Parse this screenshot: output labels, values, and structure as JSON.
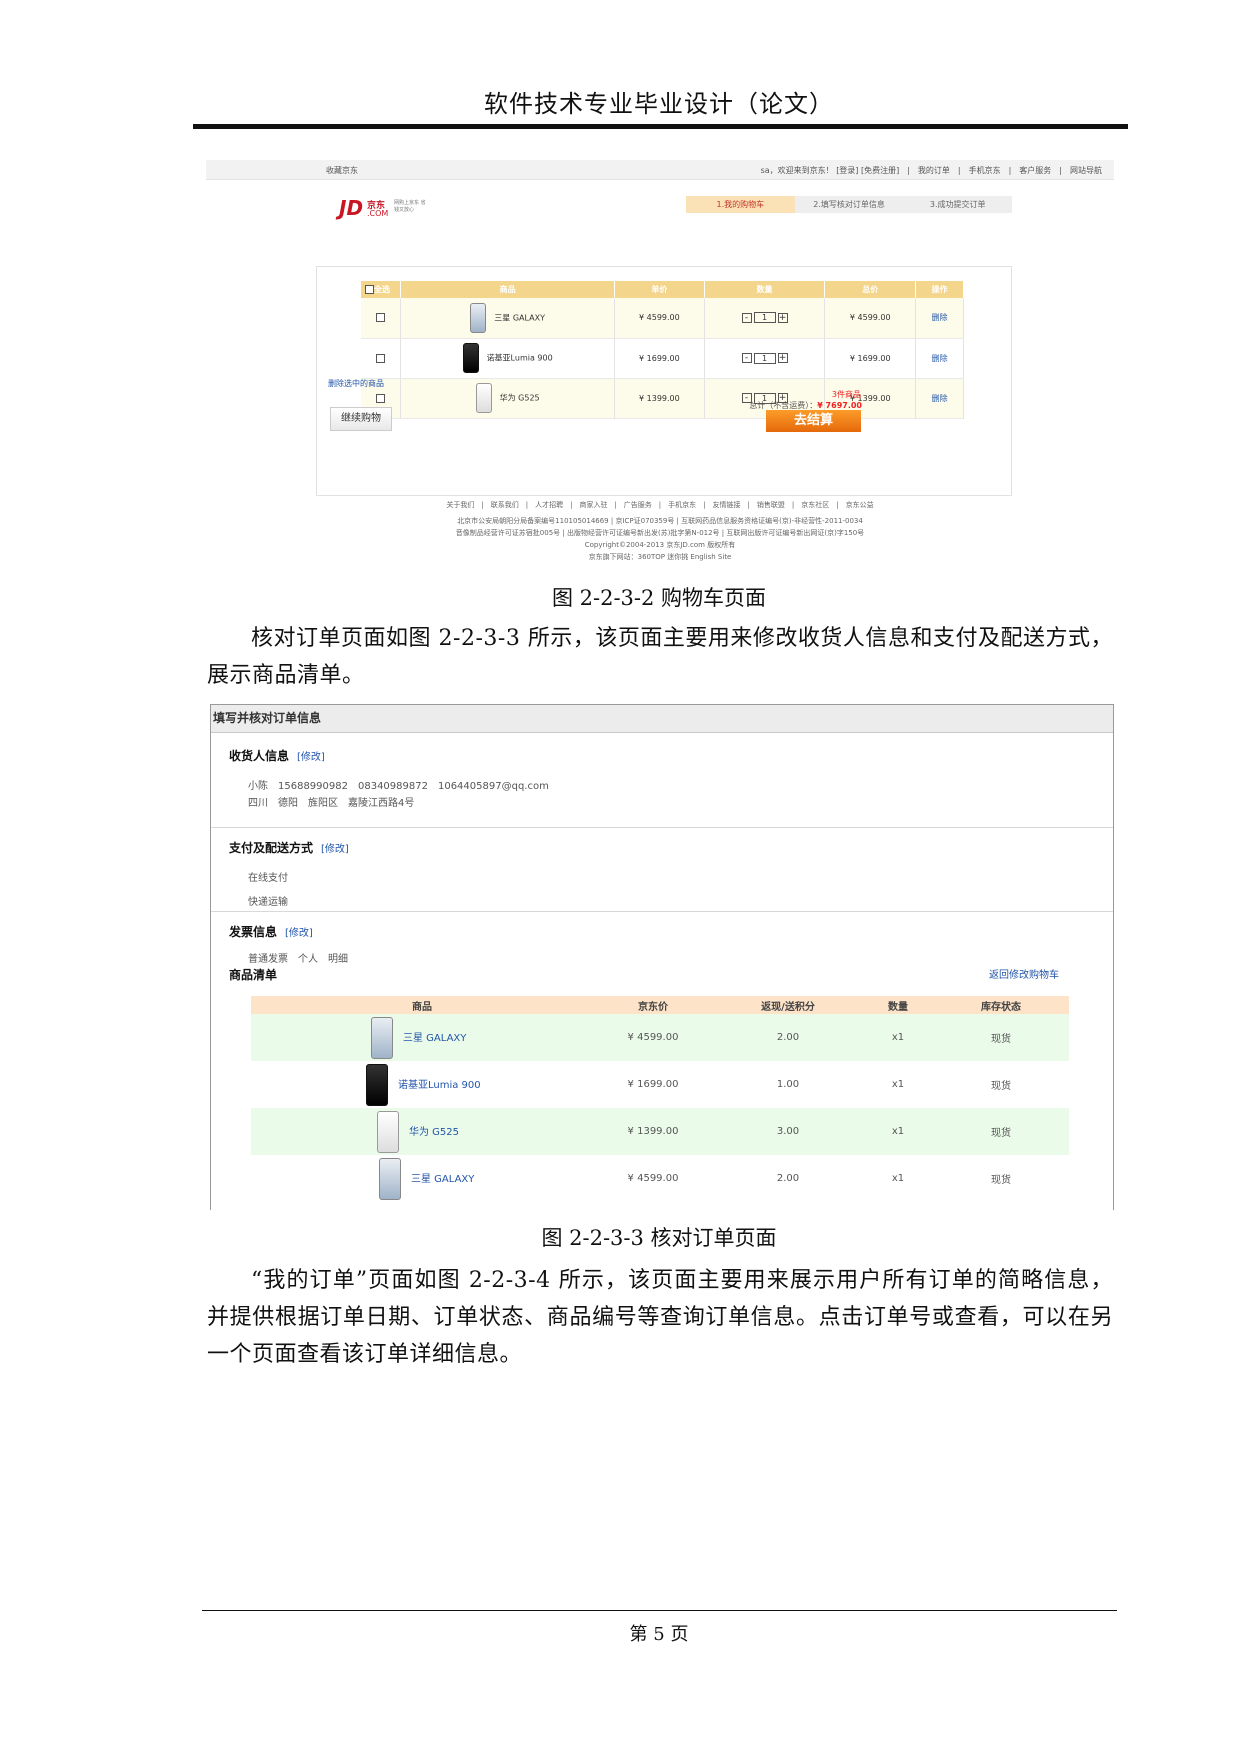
{
  "header": {
    "title": "软件技术专业毕业设计（论文）"
  },
  "fig1": {
    "topbar": {
      "favorite": "收藏京东",
      "links": "sa，欢迎来到京东！ [登录] [免费注册]　|　我的订单　|　手机京东　|　客户服务　|　网站导航"
    },
    "logo": {
      "mark": "JD",
      "name": "京东",
      "domain": ".COM",
      "slogan": "网购上京东 省钱又放心"
    },
    "steps": [
      "1.我的购物车",
      "2.填写核对订单信息",
      "3.成功提交订单"
    ],
    "table": {
      "headers": [
        "全选",
        "商品",
        "单价",
        "数量",
        "总价",
        "操作"
      ],
      "rows": [
        {
          "name": "三星 GALAXY",
          "price": "¥ 4599.00",
          "qty": "1",
          "total": "¥ 4599.00",
          "op": "删除"
        },
        {
          "name": "诺基亚Lumia 900",
          "price": "¥ 1699.00",
          "qty": "1",
          "total": "¥ 1699.00",
          "op": "删除"
        },
        {
          "name": "华为 G525",
          "price": "¥ 1399.00",
          "qty": "1",
          "total": "¥ 1399.00",
          "op": "删除"
        }
      ]
    },
    "delete_selected": "删除选中的商品",
    "count": "3件商品",
    "total_label": "总计（不含运费）：",
    "total_value": "¥ 7697.00",
    "continue_button": "继续购物",
    "checkout_button": "去结算",
    "footer": [
      "关于我们　|　联系我们　|　人才招聘　|　商家入驻　|　广告服务　|　手机京东　|　友情链接　|　销售联盟　|　京东社区　|　京东公益",
      "北京市公安局朝阳分局备案编号110105014669 | 京ICP证070359号 | 互联网药品信息服务资格证编号(京)-非经营性-2011-0034",
      "音像制品经营许可证苏宿批005号 | 出版物经营许可证编号新出发(苏)批字第N-012号 | 互联网出版许可证编号新出网证(京)字150号",
      "Copyright©2004-2013  京东JD.com 版权所有",
      "京东旗下网站：360TOP  迷你挑  English Site"
    ]
  },
  "captions": {
    "fig1": "图 2-2-3-2  购物车页面",
    "fig2": "图 2-2-3-3  核对订单页面"
  },
  "paragraphs": {
    "p1": "核对订单页面如图 2-2-3-3 所示，该页面主要用来修改收货人信息和支付及配送方式，展示商品清单。",
    "p2": "“我的订单”页面如图 2-2-3-4 所示，该页面主要用来展示用户所有订单的简略信息，并提供根据订单日期、订单状态、商品编号等查询订单信息。点击订单号或查看，可以在另一个页面查看该订单详细信息。"
  },
  "fig2": {
    "title": "填写并核对订单信息",
    "modify": "[修改]",
    "receiver": {
      "label": "收货人信息",
      "line1": "小陈　15688990982　08340989872　1064405897@qq.com",
      "line2": "四川　德阳　旌阳区　嘉陵江西路4号"
    },
    "payment": {
      "label": "支付及配送方式",
      "pay": "在线支付",
      "ship": "快递运输"
    },
    "invoice": {
      "label": "发票信息",
      "detail": "普通发票　个人　明细"
    },
    "list": {
      "label": "商品清单",
      "back": "返回修改购物车",
      "headers": [
        "商品",
        "京东价",
        "返现/送积分",
        "数量",
        "库存状态"
      ],
      "rows": [
        {
          "name": "三星 GALAXY",
          "price": "¥ 4599.00",
          "points": "2.00",
          "qty": "x1",
          "stock": "现货"
        },
        {
          "name": "诺基亚Lumia 900",
          "price": "¥ 1699.00",
          "points": "1.00",
          "qty": "x1",
          "stock": "现货"
        },
        {
          "name": "华为 G525",
          "price": "¥ 1399.00",
          "points": "3.00",
          "qty": "x1",
          "stock": "现货"
        },
        {
          "name": "三星 GALAXY",
          "price": "¥ 4599.00",
          "points": "2.00",
          "qty": "x1",
          "stock": "现货"
        }
      ]
    }
  },
  "footer": {
    "page": "第 5 页"
  }
}
